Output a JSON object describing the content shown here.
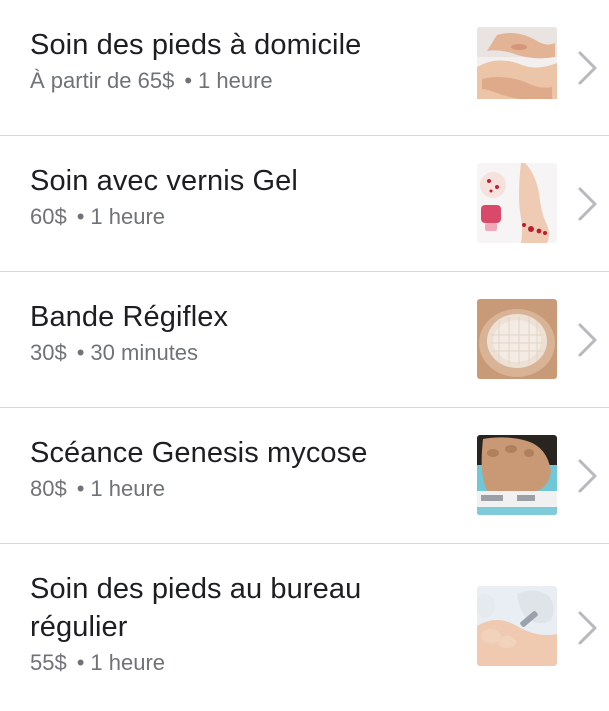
{
  "services": [
    {
      "title": "Soin des pieds à domicile",
      "price": "À partir de 65$",
      "duration": "1 heure",
      "thumb": "foot-care-home-photo"
    },
    {
      "title": "Soin avec vernis Gel",
      "price": "60$",
      "duration": "1 heure",
      "thumb": "gel-polish-feet-photo"
    },
    {
      "title": "Bande Régiflex",
      "price": "30$",
      "duration": "30 minutes",
      "thumb": "regiflex-band-nail-photo"
    },
    {
      "title": "Scéance Genesis mycose",
      "price": "80$",
      "duration": "1 heure",
      "thumb": "genesis-mycosis-device-photo"
    },
    {
      "title": "Soin des pieds au bureau régulier",
      "price": "55$",
      "duration": "1 heure",
      "thumb": "office-foot-care-photo"
    }
  ],
  "separator": "•",
  "colors": {
    "title": "#1c1e21",
    "subtitle": "#6f7378",
    "chevron": "#b8b8bd",
    "divider": "#d9d9dc"
  },
  "icons": {
    "chevron": "chevron-right-icon"
  }
}
